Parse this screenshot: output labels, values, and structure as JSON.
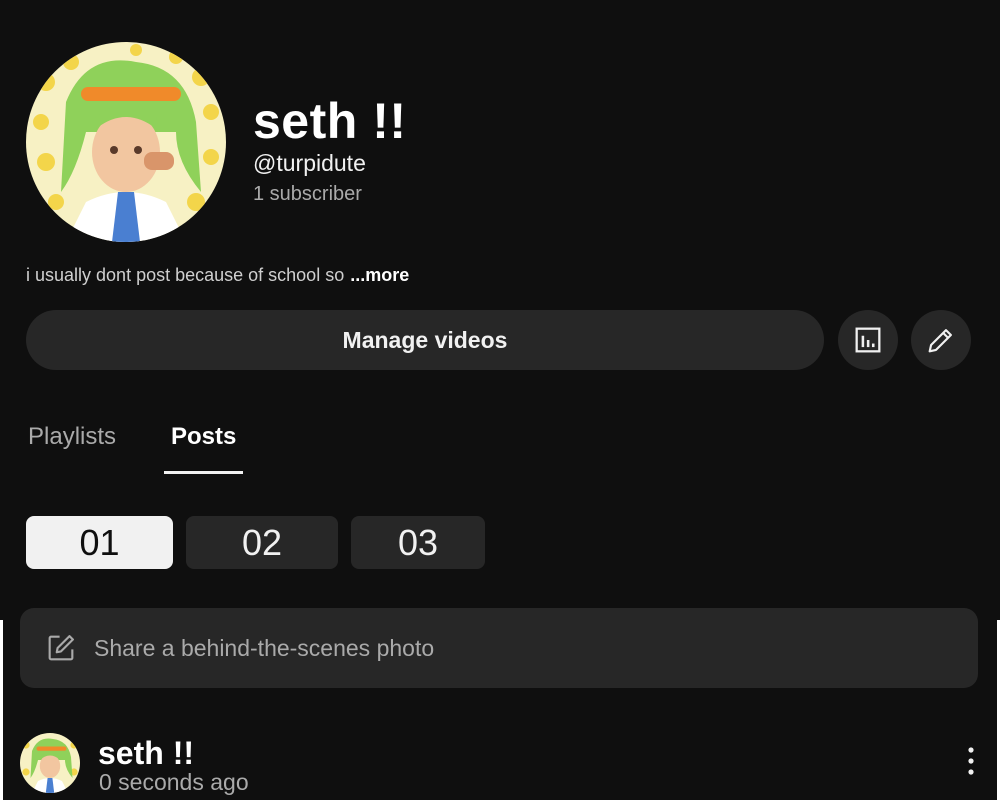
{
  "channel": {
    "name": "seth !!",
    "handle": "@turpidute",
    "subscribers": "1 subscriber",
    "description": "i usually dont post because of school so",
    "more_label": "...more"
  },
  "actions": {
    "manage_videos_label": "Manage videos",
    "analytics_icon": "analytics-icon",
    "edit_icon": "pencil-icon"
  },
  "tabs": [
    {
      "label": "Playlists",
      "active": false
    },
    {
      "label": "Posts",
      "active": true
    }
  ],
  "chips": [
    {
      "label": "01",
      "selected": true
    },
    {
      "label": "02",
      "selected": false
    },
    {
      "label": "03",
      "selected": false
    }
  ],
  "composer": {
    "icon": "edit-square-icon",
    "placeholder": "Share a behind-the-scenes photo"
  },
  "post": {
    "author": "seth !!",
    "time": "0 seconds ago",
    "menu_icon": "more-vertical-icon"
  },
  "colors": {
    "background": "#0f0f0f",
    "surface": "#272727",
    "text_primary": "#f1f1f1",
    "text_secondary": "#aaaaaa"
  }
}
